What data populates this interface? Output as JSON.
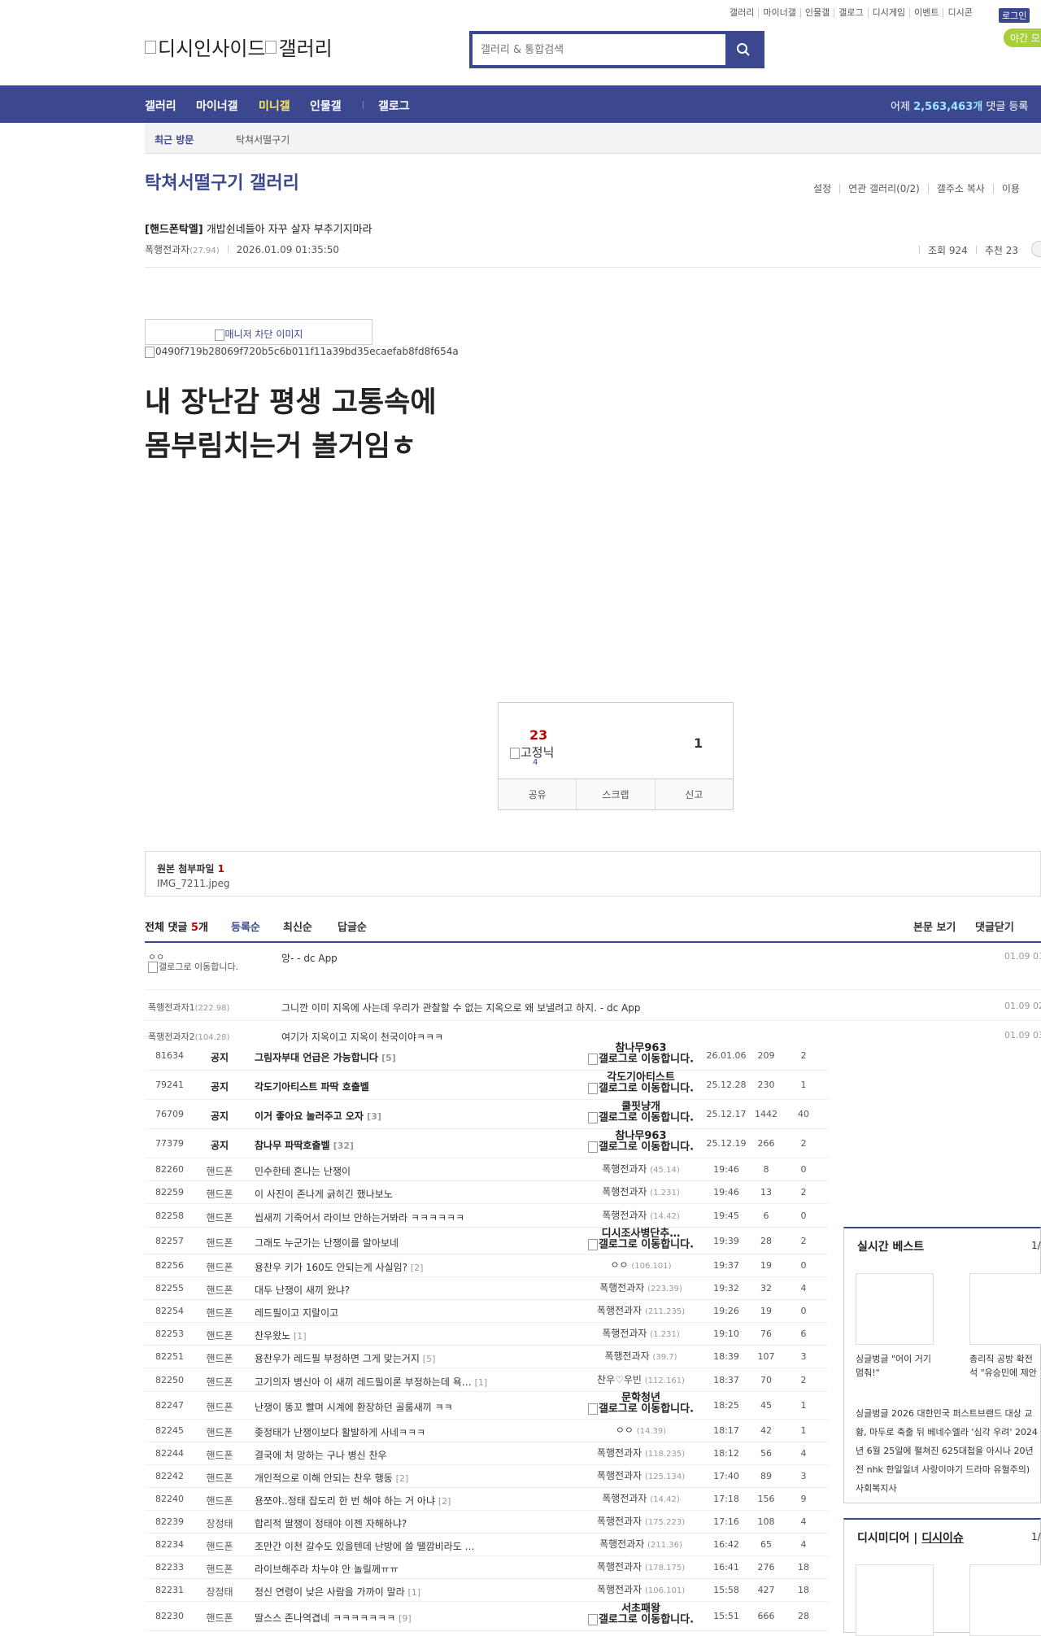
{
  "top_util": [
    "갤러리",
    "마이너갤",
    "인물갤",
    "갤로그",
    "디시게임",
    "이벤트",
    "디시콘"
  ],
  "login_label": "로그인",
  "night_label": "야간 모",
  "logo": {
    "part1": "디시인사이드",
    "part2": "갤러리"
  },
  "search": {
    "placeholder": "갤러리 & 통합검색"
  },
  "gnb": {
    "items": [
      "갤러리",
      "마이너갤",
      "미니갤",
      "인물갤",
      "갤로그"
    ],
    "stat_prefix": "어제",
    "stat_value": "2,563,463개",
    "stat_suffix": "댓글 등록"
  },
  "visit": {
    "label": "최근 방문",
    "link": "탁쳐서떨구기"
  },
  "gallery_title": "탁쳐서떨구기 갤러리",
  "gallery_menu": [
    "설정",
    "연관 갤러리(0/2)",
    "갤주소 복사",
    "이용"
  ],
  "post": {
    "head": "[핸드폰탁멜]",
    "title": "개밥쉰네들아 자꾸 살자 부추기지마라",
    "writer": "폭행전과자",
    "writer_ip": "(27.94)",
    "date": "2026.01.09 01:35:50",
    "views": "조회 924",
    "recommend": "추천 23",
    "block_img_alt": "매니저 차단 이미지",
    "img_alt": "0490f719b28069f720b5c6b011f11a39bd35ecaefab8fd8f654a",
    "body_line1": "내 장난감 평생 고통속에",
    "body_line2": "몸부림치는거 볼거임ㅎ"
  },
  "rec": {
    "up": "23",
    "fix_alt": "고정닉",
    "fix_count": "4",
    "down": "1",
    "btns": [
      "공유",
      "스크랩",
      "신고"
    ]
  },
  "attach": {
    "label": "원본 첨부파일",
    "count": "1",
    "file": "IMG_7211.jpeg"
  },
  "comments_head": {
    "label": "전체 댓글",
    "count": "5",
    "unit": "개",
    "tabs": [
      "등록순",
      "최신순",
      "답글순"
    ],
    "right": [
      "본문 보기",
      "댓글닫기"
    ]
  },
  "comments": [
    {
      "nick": "ㅇㅇ",
      "ip": "",
      "sub": "갤로그로 이동합니다.",
      "text": "앙- - dc App",
      "date": "01.09 01"
    },
    {
      "nick": "폭행전과자1",
      "ip": "(222.98)",
      "sub": "",
      "text": "그니깐 이미 지옥에 사는데 우리가 관찰할 수 없는 지옥으로 왜 보낼려고 하지. - dc App",
      "date": "01.09 02"
    },
    {
      "nick": "폭행전과자2",
      "ip": "(104.28)",
      "sub": "",
      "text": "여기가 지옥이고 지옥이 천국이야ㅋㅋㅋ",
      "date": "01.09 03"
    }
  ],
  "rows": [
    {
      "no": "81634",
      "sub": "공지",
      "title": "그림자부대 언급은 가능합니다",
      "rc": "[5]",
      "writer": "참나무963",
      "gallog": true,
      "ip": "",
      "date": "26.01.06",
      "views": "209",
      "rec": "2",
      "notice": true
    },
    {
      "no": "79241",
      "sub": "공지",
      "title": "각도기아티스트 파딱 호출벨",
      "rc": "",
      "writer": "각도기아티스트",
      "gallog": true,
      "ip": "",
      "date": "25.12.28",
      "views": "230",
      "rec": "1",
      "notice": true
    },
    {
      "no": "76709",
      "sub": "공지",
      "title": "이거 좋아요 눌러주고 오자",
      "rc": "[3]",
      "writer": "쿨핏냥개",
      "gallog": true,
      "ip": "",
      "date": "25.12.17",
      "views": "1442",
      "rec": "40",
      "notice": true
    },
    {
      "no": "77379",
      "sub": "공지",
      "title": "참나무 파딱호출벨",
      "rc": "[32]",
      "writer": "참나무963",
      "gallog": true,
      "ip": "",
      "date": "25.12.19",
      "views": "266",
      "rec": "2",
      "notice": true
    },
    {
      "no": "82260",
      "sub": "핸드폰",
      "title": "민수한테 혼나는 난쟁이",
      "rc": "",
      "writer": "폭행전과자",
      "gallog": false,
      "ip": "(45.14)",
      "date": "19:46",
      "views": "8",
      "rec": "0"
    },
    {
      "no": "82259",
      "sub": "핸드폰",
      "title": "이 사진이 존나게 긁히긴 했나보노",
      "rc": "",
      "writer": "폭행전과자",
      "gallog": false,
      "ip": "(1.231)",
      "date": "19:46",
      "views": "13",
      "rec": "2"
    },
    {
      "no": "82258",
      "sub": "핸드폰",
      "title": "씹새끼 기죽어서 라이브 안하는거봐라 ㅋㅋㅋㅋㅋㅋ",
      "rc": "",
      "writer": "폭행전과자",
      "gallog": false,
      "ip": "(14.42)",
      "date": "19:45",
      "views": "6",
      "rec": "0"
    },
    {
      "no": "82257",
      "sub": "핸드폰",
      "title": "그래도 누군가는 난쟁이를 알아보네",
      "rc": "",
      "writer": "디시조사병단추…",
      "gallog": true,
      "ip": "",
      "date": "19:39",
      "views": "28",
      "rec": "2"
    },
    {
      "no": "82256",
      "sub": "핸드폰",
      "title": "용찬우 키가 160도 안되는게 사실임?",
      "rc": "[2]",
      "writer": "ㅇㅇ",
      "gallog": false,
      "ip": "(106.101)",
      "date": "19:37",
      "views": "19",
      "rec": "0"
    },
    {
      "no": "82255",
      "sub": "핸드폰",
      "title": "대두 난쟁이 새끼 왔냐?",
      "rc": "",
      "writer": "폭행전과자",
      "gallog": false,
      "ip": "(223.39)",
      "date": "19:32",
      "views": "32",
      "rec": "4"
    },
    {
      "no": "82254",
      "sub": "핸드폰",
      "title": "레드필이고 지랄이고",
      "rc": "",
      "writer": "폭행전과자",
      "gallog": false,
      "ip": "(211.235)",
      "date": "19:26",
      "views": "19",
      "rec": "0"
    },
    {
      "no": "82253",
      "sub": "핸드폰",
      "title": "찬우왔노",
      "rc": "[1]",
      "writer": "폭행전과자",
      "gallog": false,
      "ip": "(1.231)",
      "date": "19:10",
      "views": "76",
      "rec": "6"
    },
    {
      "no": "82251",
      "sub": "핸드폰",
      "title": "용찬우가 레드필 부정하면 그게 맞는거지",
      "rc": "[5]",
      "writer": "폭행전과자",
      "gallog": false,
      "ip": "(39.7)",
      "date": "18:39",
      "views": "107",
      "rec": "3"
    },
    {
      "no": "82250",
      "sub": "핸드폰",
      "title": "고기의자 병신아 이 새끼 레드필이론 부정하는데 욕…",
      "rc": "[1]",
      "writer": "찬우♡우빈",
      "gallog": false,
      "ip": "(112.161)",
      "date": "18:37",
      "views": "70",
      "rec": "2"
    },
    {
      "no": "82247",
      "sub": "핸드폰",
      "title": "난쟁이 똥꼬 빨며 시계에 환장하던 골룸새끼 ㅋㅋ",
      "rc": "",
      "writer": "문학청년",
      "gallog": true,
      "ip": "",
      "date": "18:25",
      "views": "45",
      "rec": "1"
    },
    {
      "no": "82245",
      "sub": "핸드폰",
      "title": "좆정태가 난쟁이보다 활발하게 사네ㅋㅋㅋ",
      "rc": "",
      "writer": "ㅇㅇ",
      "gallog": false,
      "ip": "(14.39)",
      "date": "18:17",
      "views": "42",
      "rec": "1"
    },
    {
      "no": "82244",
      "sub": "핸드폰",
      "title": "결국에 처 망하는 구나 병신 찬우",
      "rc": "",
      "writer": "폭행전과자",
      "gallog": false,
      "ip": "(118.235)",
      "date": "18:12",
      "views": "56",
      "rec": "4"
    },
    {
      "no": "82242",
      "sub": "핸드폰",
      "title": "개인적으로 이해 안되는 찬우 행동",
      "rc": "[2]",
      "writer": "폭행전과자",
      "gallog": false,
      "ip": "(125.134)",
      "date": "17:40",
      "views": "89",
      "rec": "3"
    },
    {
      "no": "82240",
      "sub": "핸드폰",
      "title": "용쪼야..정태 잡도리 한 번 해야 하는 거 아냐",
      "rc": "[2]",
      "writer": "폭행전과자",
      "gallog": false,
      "ip": "(14.42)",
      "date": "17:18",
      "views": "156",
      "rec": "9"
    },
    {
      "no": "82239",
      "sub": "장정태",
      "title": "합리적 딸쟁이 정태야 이젠 자해하냐?",
      "rc": "",
      "writer": "폭행전과자",
      "gallog": false,
      "ip": "(175.223)",
      "date": "17:16",
      "views": "108",
      "rec": "4"
    },
    {
      "no": "82234",
      "sub": "핸드폰",
      "title": "조만간 이천 갈수도 있을텐데 난방에 쓸 땔깜비라도 …",
      "rc": "",
      "writer": "폭행전과자",
      "gallog": false,
      "ip": "(211.36)",
      "date": "16:42",
      "views": "65",
      "rec": "4"
    },
    {
      "no": "82233",
      "sub": "핸드폰",
      "title": "라이브해주라 차누야 안 놀릴께ㅠㅠ",
      "rc": "",
      "writer": "폭행전과자",
      "gallog": false,
      "ip": "(178.175)",
      "date": "16:41",
      "views": "276",
      "rec": "18"
    },
    {
      "no": "82231",
      "sub": "장정태",
      "title": "정신 연령이 낮은 사람을 가까이 말라",
      "rc": "[1]",
      "writer": "폭행전과자",
      "gallog": false,
      "ip": "(106.101)",
      "date": "15:58",
      "views": "427",
      "rec": "18"
    },
    {
      "no": "82230",
      "sub": "핸드폰",
      "title": "딸스스 존나역겹네 ㅋㅋㅋㅋㅋㅋㅋ",
      "rc": "[9]",
      "writer": "서초패왕",
      "gallog": true,
      "ip": "",
      "date": "15:51",
      "views": "666",
      "rec": "28"
    }
  ],
  "gallog_alt": "갤로그로 이동합니다.",
  "side_best": {
    "title": "실시간 베스트",
    "page": "1/",
    "cap1": "싱글벙글 \"어이 거기 멈춰!\"",
    "cap2": "총리직 공방 확전 석 \"유승민에 제안",
    "desc": "싱글벙글 2026 대한민국 퍼스트브랜드 대상 교황, 마두로 축출 뒤 베네수엘라 '심각 우려' 2024년 6월 25일에 펼쳐진 625대첩을 아시나 20년전 nhk 한일일녀 사랑이야기 드라마 유혈주의) 사회복지사"
  },
  "side_media": {
    "title1": "디시미디어",
    "title2": "디시이슈",
    "page": "1/"
  }
}
